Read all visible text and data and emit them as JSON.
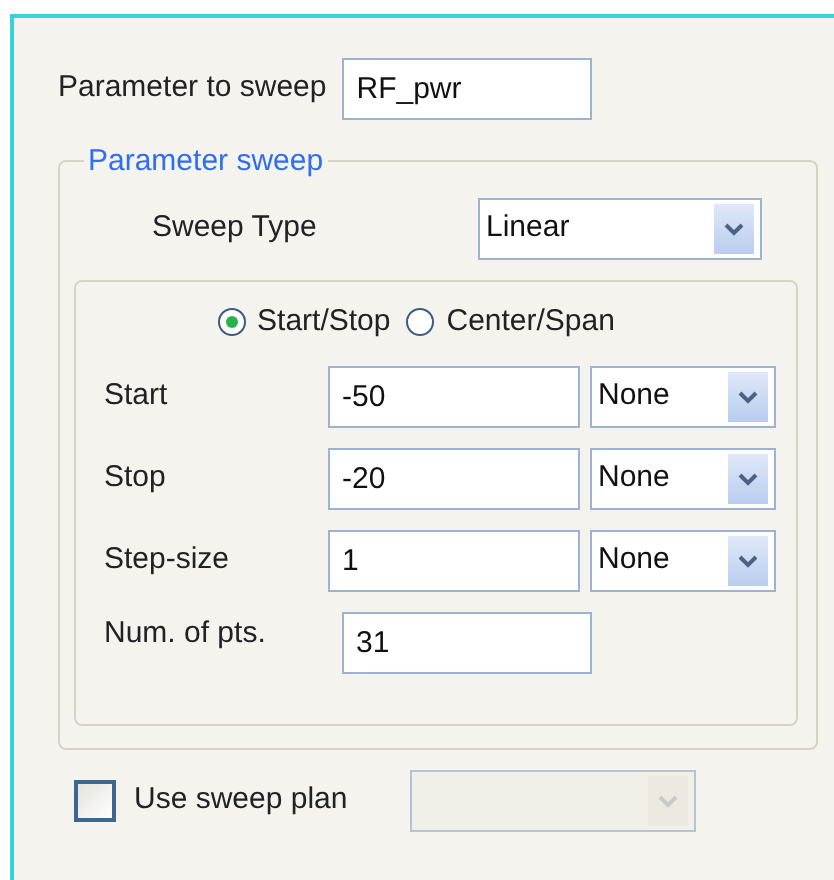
{
  "parameter_to_sweep": {
    "label": "Parameter to sweep",
    "value": "RF_pwr"
  },
  "parameter_sweep": {
    "title": "Parameter sweep",
    "sweep_type": {
      "label": "Sweep Type",
      "value": "Linear"
    },
    "modes": [
      {
        "label": "Start/Stop",
        "selected": true
      },
      {
        "label": "Center/Span",
        "selected": false
      }
    ],
    "rows": [
      {
        "label": "Start",
        "value": "-50",
        "unit": "None"
      },
      {
        "label": "Stop",
        "value": "-20",
        "unit": "None"
      },
      {
        "label": "Step-size",
        "value": "1",
        "unit": "None"
      }
    ],
    "num_points": {
      "label": "Num. of pts.",
      "value": "31"
    }
  },
  "use_sweep_plan": {
    "label": "Use sweep plan",
    "checked": false,
    "disabled": true
  }
}
